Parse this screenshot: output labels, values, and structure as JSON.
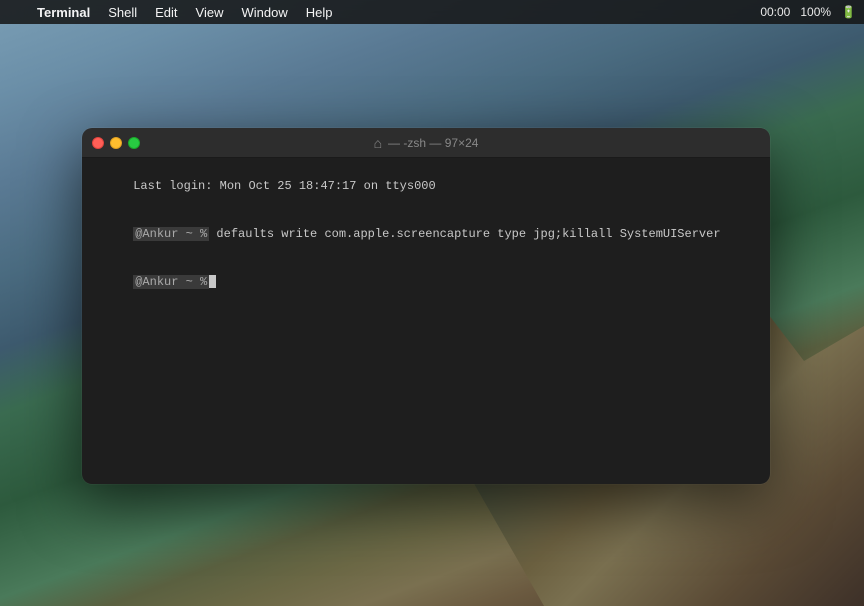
{
  "desktop": {
    "bg_description": "macOS Big Sur rocky landscape"
  },
  "menubar": {
    "apple_symbol": "",
    "app_name": "Terminal",
    "items": [
      "Shell",
      "Edit",
      "View",
      "Window",
      "Help"
    ],
    "right": {
      "time": "00:00",
      "battery_percent": "100%",
      "battery_icon": "🔋"
    }
  },
  "terminal": {
    "titlebar": {
      "title": "— -zsh — 97×24",
      "home_icon": "⌂"
    },
    "traffic_lights": {
      "close_label": "close",
      "minimize_label": "minimize",
      "maximize_label": "maximize"
    },
    "lines": [
      {
        "type": "login",
        "text": "Last login: Mon Oct 25 18:47:17 on ttys000"
      },
      {
        "type": "command",
        "prompt": "@Ankur ~ %",
        "command": " defaults write com.apple.screencapture type jpg;killall SystemUIServer"
      },
      {
        "type": "prompt",
        "prompt": "@Ankur ~ %",
        "command": " "
      }
    ]
  }
}
